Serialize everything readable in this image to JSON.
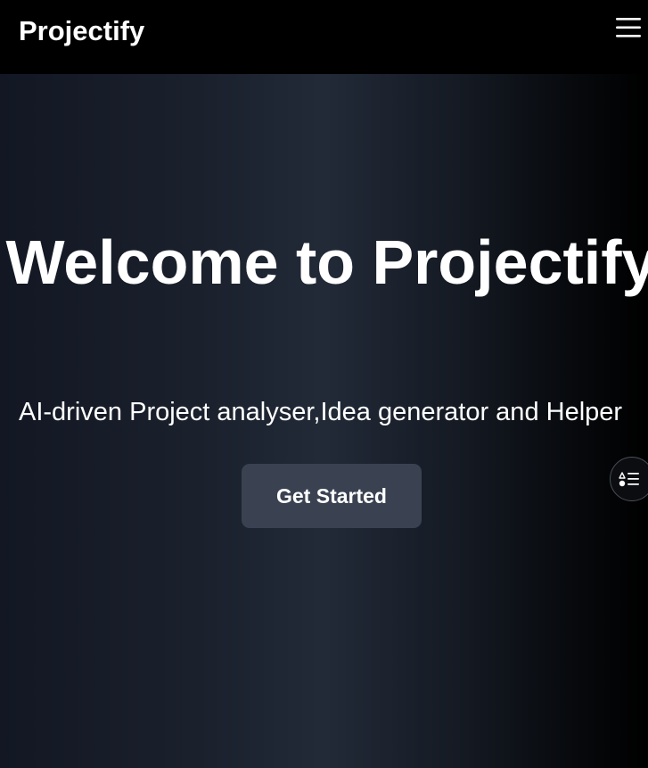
{
  "header": {
    "brand": "Projectify",
    "menu_icon": "hamburger-menu-icon"
  },
  "hero": {
    "title": "Welcome to Projectify",
    "subtitle": "AI-driven Project analyser,Idea generator and Helper",
    "cta_label": "Get Started"
  },
  "floating_button": {
    "icon": "shapes-list-icon"
  },
  "colors": {
    "header_bg": "#000000",
    "hero_bg": "#1a202c",
    "button_bg": "#3a4252",
    "text": "#ffffff"
  }
}
